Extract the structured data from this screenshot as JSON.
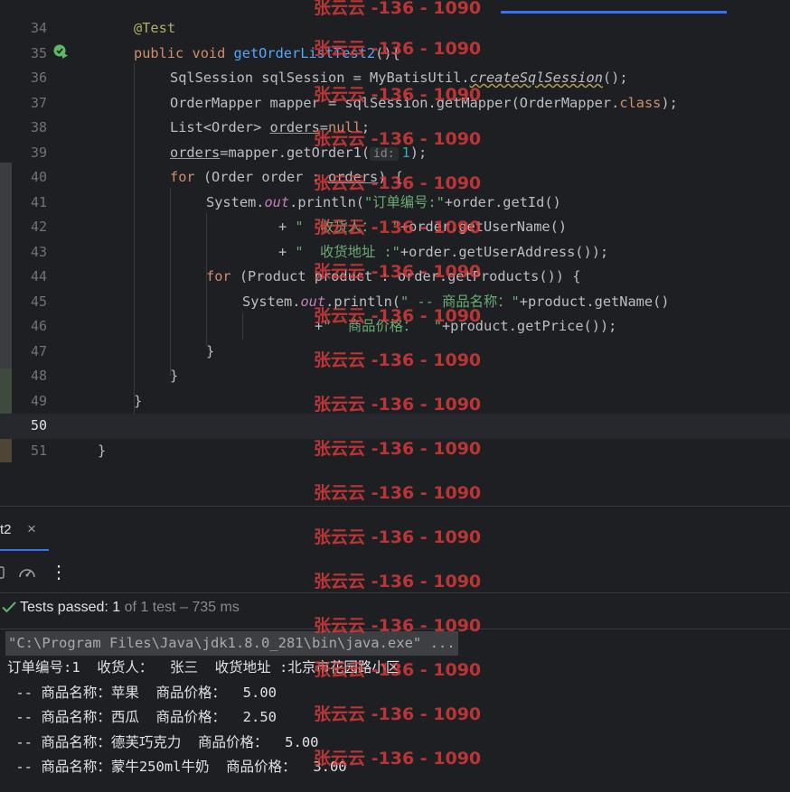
{
  "editor": {
    "lines": [
      {
        "num": "34"
      },
      {
        "num": "35"
      },
      {
        "num": "36"
      },
      {
        "num": "37"
      },
      {
        "num": "38"
      },
      {
        "num": "39"
      },
      {
        "num": "40"
      },
      {
        "num": "41"
      },
      {
        "num": "42"
      },
      {
        "num": "43"
      },
      {
        "num": "44"
      },
      {
        "num": "45"
      },
      {
        "num": "46"
      },
      {
        "num": "47"
      },
      {
        "num": "48"
      },
      {
        "num": "49"
      },
      {
        "num": "50"
      },
      {
        "num": "51"
      }
    ],
    "code": {
      "l34_ann": "@Test",
      "l35_kw1": "public",
      "l35_kw2": "void",
      "l35_method": "getOrderListTest2",
      "l35_rest": "(){",
      "l36_a": "SqlSession sqlSession = MyBatisUtil.",
      "l36_b": "createSqlSession",
      "l36_c": "();",
      "l37_a": "OrderMapper mapper = sqlSession.getMapper(OrderMapper.",
      "l37_b": "class",
      "l37_c": ");",
      "l38_a": "List<Order> ",
      "l38_b": "orders",
      "l38_c": "=",
      "l38_d": "null",
      "l38_e": ";",
      "l39_a": "orders",
      "l39_b": "=mapper.getOrder1(",
      "l39_hint": "id:",
      "l39_num": "1",
      "l39_c": ");",
      "l40_kw": "for",
      "l40_a": " (Order order : ",
      "l40_b": "orders",
      "l40_c": ") {",
      "l41_a": "System.",
      "l41_out": "out",
      "l41_b": ".println(",
      "l41_str": "\"订单编号:\"",
      "l41_c": "+order.getId()",
      "l42_a": "+ ",
      "l42_str": "\"  收货人：  \"",
      "l42_c": "+order.getUserName()",
      "l43_a": "+ ",
      "l43_str": "\"  收货地址 :\"",
      "l43_c": "+order.getUserAddress());",
      "l44_kw": "for",
      "l44_a": " (Product product : order.getProducts()) {",
      "l45_a": "System.",
      "l45_out": "out",
      "l45_b": ".println(",
      "l45_str": "\" -- 商品名称：\"",
      "l45_c": "+product.getName()",
      "l46_a": "+",
      "l46_str": "\"  商品价格：  \"",
      "l46_c": "+product.getPrice());",
      "l47": "}",
      "l48": "}",
      "l49": "}",
      "l51": "}"
    }
  },
  "run_panel": {
    "tab_label": "t2",
    "tab_close": "×",
    "more_menu": "⋮",
    "status_bold": "Tests passed: ",
    "status_count": "1",
    "status_muted": " of 1 test – 735 ms"
  },
  "console": {
    "command": "\"C:\\Program Files\\Java\\jdk1.8.0_281\\bin\\java.exe\" ...",
    "lines": [
      "订单编号:1  收货人：  张三  收货地址 :北京市花园路小区",
      " -- 商品名称：苹果  商品价格：  5.00",
      " -- 商品名称：西瓜  商品价格：  2.50",
      " -- 商品名称：德芙巧克力  商品价格：  5.00",
      " -- 商品名称：蒙牛250ml牛奶  商品价格：  3.00"
    ]
  },
  "watermark": {
    "text": "张云云 -136 - 1090"
  },
  "colors": {
    "background": "#1e1f22",
    "keyword": "#cf8e6d",
    "method": "#56a8f5",
    "string": "#6aab73",
    "annotation": "#b3ae60",
    "number": "#2aacb8",
    "static_field": "#c77dbb",
    "success": "#5fb865",
    "watermark": "#e03b3b"
  }
}
